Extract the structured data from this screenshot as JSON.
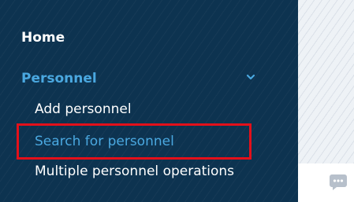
{
  "sidebar": {
    "home_label": "Home",
    "section": {
      "label": "Personnel",
      "expanded": true,
      "icon": "chevron-down-icon",
      "items": [
        {
          "label": "Add personnel",
          "active": false
        },
        {
          "label": "Search for personnel",
          "active": true
        },
        {
          "label": "Multiple personnel operations",
          "active": false
        }
      ]
    }
  },
  "overlay": {
    "highlight_target": "Search for personnel"
  },
  "chat_widget": {
    "icon": "chat-bubble-icon"
  },
  "colors": {
    "sidebar_bg": "#0d3350",
    "accent": "#4aa8e0",
    "text": "#ffffff",
    "highlight": "#e3101a",
    "widget": "#b7c0cb"
  }
}
